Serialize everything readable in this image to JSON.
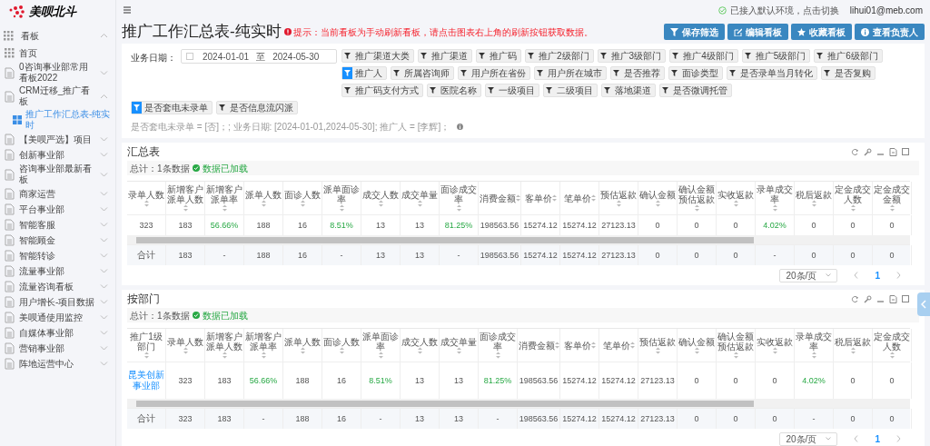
{
  "brand": {
    "name": "美呗北斗"
  },
  "sidebar": {
    "label": "看板",
    "expanded": true,
    "items": [
      {
        "label": "首页",
        "kind": "home"
      },
      {
        "label": "0咨询事业部常用看板2022",
        "kind": "folder",
        "expanded": false
      },
      {
        "label": "CRM迁移_推广看板",
        "kind": "folder",
        "expanded": true,
        "children": [
          {
            "label": "推广工作汇总表-纯实时",
            "selected": true
          }
        ]
      },
      {
        "label": "【美呗严选】项目",
        "kind": "folder",
        "expanded": false
      },
      {
        "label": "创新事业部",
        "kind": "folder",
        "expanded": false
      },
      {
        "label": "咨询事业部最新看板",
        "kind": "folder",
        "expanded": false
      },
      {
        "label": "商家运营",
        "kind": "folder",
        "expanded": false
      },
      {
        "label": "平台事业部",
        "kind": "folder",
        "expanded": false
      },
      {
        "label": "智能客服",
        "kind": "folder",
        "expanded": false
      },
      {
        "label": "智能顾金",
        "kind": "folder",
        "expanded": false
      },
      {
        "label": "智能转诊",
        "kind": "folder",
        "expanded": false
      },
      {
        "label": "流量事业部",
        "kind": "folder",
        "expanded": false
      },
      {
        "label": "流量咨询看板",
        "kind": "folder",
        "expanded": false
      },
      {
        "label": "用户增长-项目数据",
        "kind": "folder",
        "expanded": false
      },
      {
        "label": "美呗通使用监控",
        "kind": "folder",
        "expanded": false
      },
      {
        "label": "自媒体事业部",
        "kind": "folder",
        "expanded": false
      },
      {
        "label": "营销事业部",
        "kind": "folder",
        "expanded": false
      },
      {
        "label": "阵地运营中心",
        "kind": "folder",
        "expanded": false
      }
    ]
  },
  "header": {
    "env_status": "已接入默认环境，点击切换",
    "user": "lihui01@meb.com"
  },
  "page": {
    "title": "推广工作汇总表-纯实时",
    "notice": "提示：当前看板为手动刷新看板，请点击图表右上角的刷新按钮获取数据。",
    "actions": [
      {
        "label": "保存筛选",
        "kind": "filter"
      },
      {
        "label": "编辑看板",
        "kind": "edit"
      },
      {
        "label": "收藏看板",
        "kind": "star"
      },
      {
        "label": "查看负责人",
        "kind": "info"
      }
    ]
  },
  "filters": {
    "date_label": "业务日期：",
    "date_from": "2024-01-01",
    "date_sep": "至",
    "date_to": "2024-05-30",
    "chips": [
      {
        "label": "推广渠道大类",
        "selected": false
      },
      {
        "label": "推广渠道",
        "selected": false
      },
      {
        "label": "推广码",
        "selected": false
      },
      {
        "label": "推广2级部门",
        "selected": false
      },
      {
        "label": "推广3级部门",
        "selected": false
      },
      {
        "label": "推广4级部门",
        "selected": false
      },
      {
        "label": "推广5级部门",
        "selected": false
      },
      {
        "label": "推广6级部门",
        "selected": false
      },
      {
        "label": "推广人",
        "selected": true
      },
      {
        "label": "所属咨询师",
        "selected": false
      },
      {
        "label": "用户所在省份",
        "selected": false
      },
      {
        "label": "用户所在城市",
        "selected": false
      },
      {
        "label": "是否推荐",
        "selected": false
      },
      {
        "label": "面诊类型",
        "selected": false
      },
      {
        "label": "是否录单当月转化",
        "selected": false
      },
      {
        "label": "是否复购",
        "selected": false
      },
      {
        "label": "推广码支付方式",
        "selected": false
      },
      {
        "label": "医院名称",
        "selected": false
      },
      {
        "label": "一级项目",
        "selected": false
      },
      {
        "label": "二级项目",
        "selected": false
      },
      {
        "label": "落地渠道",
        "selected": false
      },
      {
        "label": "是否微调托管",
        "selected": false
      }
    ],
    "more_chips": [
      {
        "label": "是否套电未录单",
        "selected": true
      },
      {
        "label": "是否信息流闪派",
        "selected": false
      }
    ],
    "summary": "是否套电未录单 = [否]；; 业务日期: [2024-01-01,2024-05-30]; 推广人 = [李辉]；"
  },
  "tables": [
    {
      "title": "汇总表",
      "count": "总计：1条数据",
      "loaded": "数据已加载",
      "columns": [
        {
          "label": "录单人数",
          "rate": false
        },
        {
          "label": "新增客户派单人数",
          "rate": false
        },
        {
          "label": "新增客户派单率",
          "rate": true
        },
        {
          "label": "派单人数",
          "rate": false
        },
        {
          "label": "面诊人数",
          "rate": false
        },
        {
          "label": "派单面诊率",
          "rate": true
        },
        {
          "label": "成交人数",
          "rate": false
        },
        {
          "label": "成交单量",
          "rate": false
        },
        {
          "label": "面诊成交率",
          "rate": true
        },
        {
          "label": "消费金额",
          "rate": false
        },
        {
          "label": "客单价",
          "rate": false
        },
        {
          "label": "笔单价",
          "rate": false
        },
        {
          "label": "预估返款",
          "rate": false
        },
        {
          "label": "确认金额",
          "rate": false
        },
        {
          "label": "确认金额预估返款",
          "rate": false
        },
        {
          "label": "实收返款",
          "rate": false
        },
        {
          "label": "录单成交率",
          "rate": true
        },
        {
          "label": "税后返款",
          "rate": false
        },
        {
          "label": "定金成交人数",
          "rate": false
        },
        {
          "label": "定金成交金额",
          "rate": false
        }
      ],
      "rows": [
        [
          "323",
          "183",
          "56.66%",
          "188",
          "16",
          "8.51%",
          "13",
          "13",
          "81.25%",
          "198563.56",
          "15274.12",
          "15274.12",
          "27123.13",
          "0",
          "0",
          "0",
          "4.02%",
          "0",
          "0",
          "0"
        ]
      ],
      "total": [
        "合计",
        "183",
        "-",
        "188",
        "16",
        "-",
        "13",
        "13",
        "-",
        "198563.56",
        "15274.12",
        "15274.12",
        "27123.13",
        "0",
        "0",
        "0",
        "-",
        "0",
        "0",
        "0"
      ],
      "page_size": "20条/页",
      "page": "1"
    },
    {
      "title": "按部门",
      "count": "总计：1条数据",
      "loaded": "数据已加载",
      "columns": [
        {
          "label": "推广1级部门",
          "rate": false
        },
        {
          "label": "录单人数",
          "rate": false
        },
        {
          "label": "新增客户派单人数",
          "rate": false
        },
        {
          "label": "新增客户派单率",
          "rate": true
        },
        {
          "label": "派单人数",
          "rate": false
        },
        {
          "label": "面诊人数",
          "rate": false
        },
        {
          "label": "派单面诊率",
          "rate": true
        },
        {
          "label": "成交人数",
          "rate": false
        },
        {
          "label": "成交单量",
          "rate": false
        },
        {
          "label": "面诊成交率",
          "rate": true
        },
        {
          "label": "消费金额",
          "rate": false
        },
        {
          "label": "客单价",
          "rate": false
        },
        {
          "label": "笔单价",
          "rate": false
        },
        {
          "label": "预估返款",
          "rate": false
        },
        {
          "label": "确认金额",
          "rate": false
        },
        {
          "label": "确认金额预估返款",
          "rate": false
        },
        {
          "label": "实收返款",
          "rate": false
        },
        {
          "label": "录单成交率",
          "rate": true
        },
        {
          "label": "税后返款",
          "rate": false
        },
        {
          "label": "定金成交人数",
          "rate": false
        }
      ],
      "rows": [
        [
          "昆美创新事业部",
          "323",
          "183",
          "56.66%",
          "188",
          "16",
          "8.51%",
          "13",
          "13",
          "81.25%",
          "198563.56",
          "15274.12",
          "15274.12",
          "27123.13",
          "0",
          "0",
          "0",
          "4.02%",
          "0",
          "0"
        ]
      ],
      "total": [
        "合计",
        "323",
        "183",
        "-",
        "188",
        "16",
        "-",
        "13",
        "13",
        "-",
        "198563.56",
        "15274.12",
        "15274.12",
        "27123.13",
        "0",
        "0",
        "0",
        "-",
        "0",
        "0"
      ],
      "page_size": "20条/页",
      "page": "1"
    }
  ]
}
